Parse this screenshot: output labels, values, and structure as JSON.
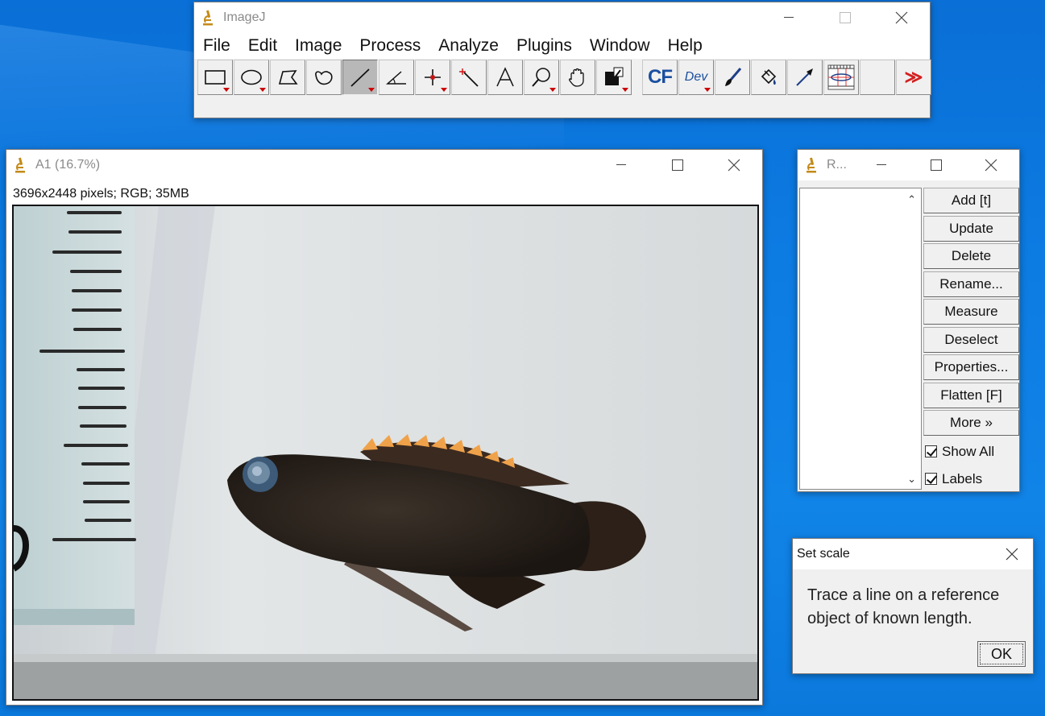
{
  "imagej": {
    "title": "ImageJ",
    "menus": [
      "File",
      "Edit",
      "Image",
      "Process",
      "Analyze",
      "Plugins",
      "Window",
      "Help"
    ],
    "tools": [
      {
        "name": "rectangle-tool-icon",
        "menu": true
      },
      {
        "name": "oval-tool-icon",
        "menu": true
      },
      {
        "name": "polygon-tool-icon",
        "menu": false
      },
      {
        "name": "freehand-tool-icon",
        "menu": false
      },
      {
        "name": "straight-line-tool-icon",
        "menu": true,
        "selected": true
      },
      {
        "name": "angle-tool-icon",
        "menu": false
      },
      {
        "name": "point-tool-icon",
        "menu": true
      },
      {
        "name": "wand-tool-icon",
        "menu": false
      },
      {
        "name": "text-tool-icon",
        "menu": false
      },
      {
        "name": "magnifying-glass-tool-icon",
        "menu": true
      },
      {
        "name": "hand-tool-icon",
        "menu": false
      },
      {
        "name": "color-picker-tool-icon",
        "menu": true
      }
    ],
    "cf_label": "CF",
    "dev_label": "Dev",
    "more_label": "≫"
  },
  "image_window": {
    "title": "A1 (16.7%)",
    "info": "3696x2448 pixels; RGB; 35MB"
  },
  "roi_manager": {
    "title": "R...",
    "buttons": [
      "Add [t]",
      "Update",
      "Delete",
      "Rename...",
      "Measure",
      "Deselect",
      "Properties...",
      "Flatten [F]",
      "More »"
    ],
    "checkboxes": [
      {
        "label": "Show All",
        "checked": true
      },
      {
        "label": "Labels",
        "checked": true
      }
    ]
  },
  "set_scale": {
    "title": "Set scale",
    "message": "Trace a line on a reference object of known length.",
    "ok_label": "OK"
  },
  "colors": {
    "desktop": "#0c7be2",
    "tool_marker": "#cc0000",
    "cf_text": "#1a4fa0"
  }
}
